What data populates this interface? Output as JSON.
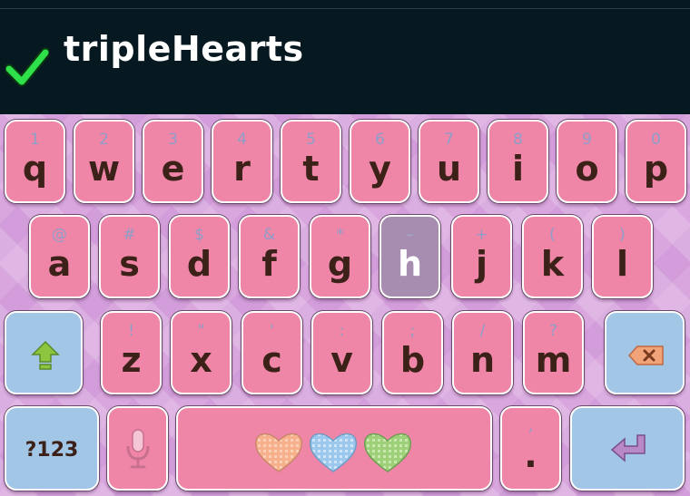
{
  "header": {
    "theme_name": "tripleHearts",
    "selected_icon": "check-icon"
  },
  "colors": {
    "key_pink": "#ef86a8",
    "key_blue": "#a2c6e6",
    "key_pressed": "#a78db0",
    "key_text": "#3b2118",
    "hint_text": "#8e9ec8",
    "header_bg": "#061820"
  },
  "keyboard": {
    "row1": [
      {
        "hint": "1",
        "label": "q"
      },
      {
        "hint": "2",
        "label": "w"
      },
      {
        "hint": "3",
        "label": "e"
      },
      {
        "hint": "4",
        "label": "r"
      },
      {
        "hint": "5",
        "label": "t"
      },
      {
        "hint": "6",
        "label": "y"
      },
      {
        "hint": "7",
        "label": "u"
      },
      {
        "hint": "8",
        "label": "i"
      },
      {
        "hint": "9",
        "label": "o"
      },
      {
        "hint": "0",
        "label": "p"
      }
    ],
    "row2": [
      {
        "hint": "@",
        "label": "a"
      },
      {
        "hint": "#",
        "label": "s"
      },
      {
        "hint": "$",
        "label": "d"
      },
      {
        "hint": "&",
        "label": "f"
      },
      {
        "hint": "*",
        "label": "g"
      },
      {
        "hint": "–",
        "label": "h"
      },
      {
        "hint": "+",
        "label": "j"
      },
      {
        "hint": "(",
        "label": "k"
      },
      {
        "hint": ")",
        "label": "l"
      }
    ],
    "row3": [
      {
        "hint": "!",
        "label": "z"
      },
      {
        "hint": "\"",
        "label": "x"
      },
      {
        "hint": "'",
        "label": "c"
      },
      {
        "hint": ":",
        "label": "v"
      },
      {
        "hint": ";",
        "label": "b"
      },
      {
        "hint": "/",
        "label": "n"
      },
      {
        "hint": "?",
        "label": "m"
      }
    ],
    "shift_icon": "shift-arrow-icon",
    "backspace_icon": "backspace-icon",
    "symbols_label": "?123",
    "mic_icon": "microphone-icon",
    "space_icon": "three-hearts-icon",
    "period_hint": ",",
    "period_label": ".",
    "enter_icon": "enter-arrow-icon",
    "pressed_key": "h"
  }
}
